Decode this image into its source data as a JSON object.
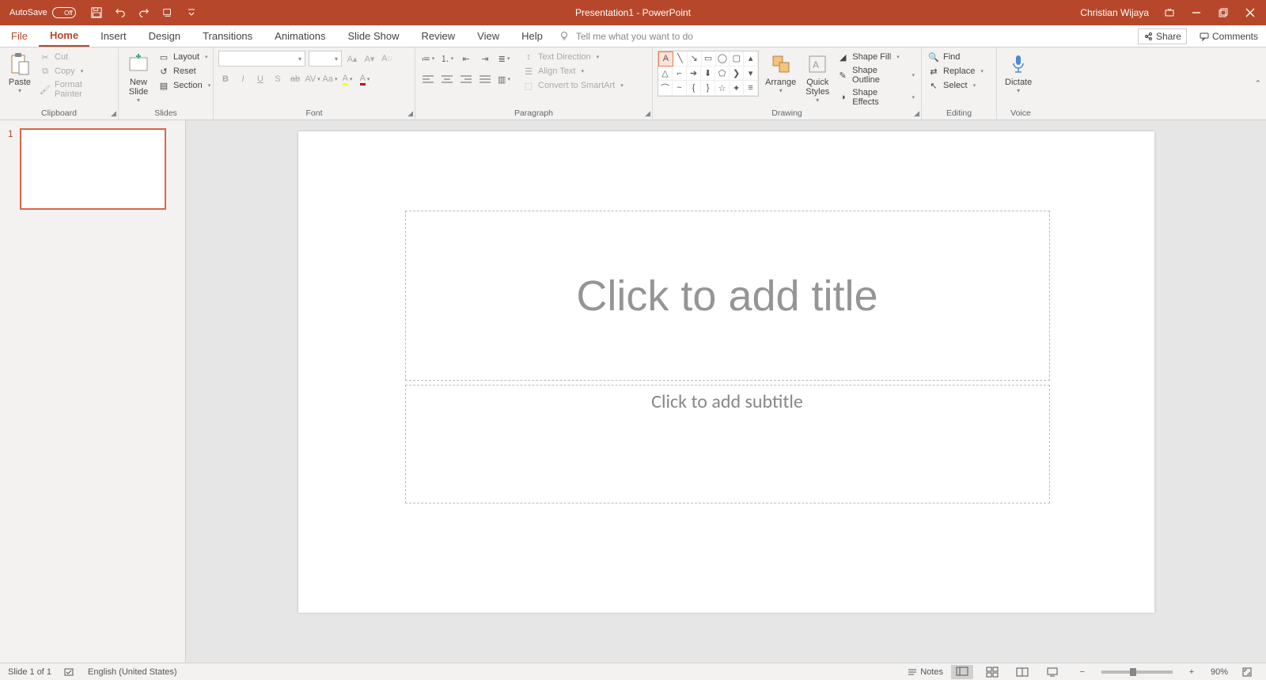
{
  "titlebar": {
    "autosave_label": "AutoSave",
    "autosave_state": "Off",
    "doc_title": "Presentation1  -  PowerPoint",
    "user_name": "Christian Wijaya"
  },
  "tabs": {
    "file": "File",
    "home": "Home",
    "insert": "Insert",
    "design": "Design",
    "transitions": "Transitions",
    "animations": "Animations",
    "slideshow": "Slide Show",
    "review": "Review",
    "view": "View",
    "help": "Help",
    "tellme": "Tell me what you want to do",
    "share": "Share",
    "comments": "Comments"
  },
  "ribbon": {
    "clipboard": {
      "paste": "Paste",
      "cut": "Cut",
      "copy": "Copy",
      "format_painter": "Format Painter",
      "label": "Clipboard"
    },
    "slides": {
      "new_slide": "New\nSlide",
      "layout": "Layout",
      "reset": "Reset",
      "section": "Section",
      "label": "Slides"
    },
    "font": {
      "label": "Font"
    },
    "paragraph": {
      "label": "Paragraph",
      "text_direction": "Text Direction",
      "align_text": "Align Text",
      "smartart": "Convert to SmartArt"
    },
    "drawing": {
      "arrange": "Arrange",
      "quick_styles": "Quick\nStyles",
      "shape_fill": "Shape Fill",
      "shape_outline": "Shape Outline",
      "shape_effects": "Shape Effects",
      "label": "Drawing"
    },
    "editing": {
      "find": "Find",
      "replace": "Replace",
      "select": "Select",
      "label": "Editing"
    },
    "voice": {
      "dictate": "Dictate",
      "label": "Voice"
    }
  },
  "slides_panel": {
    "thumb_num": "1"
  },
  "canvas": {
    "title_placeholder": "Click to add title",
    "subtitle_placeholder": "Click to add subtitle"
  },
  "statusbar": {
    "slide_pos": "Slide 1 of 1",
    "language": "English (United States)",
    "notes": "Notes",
    "zoom": "90%"
  }
}
